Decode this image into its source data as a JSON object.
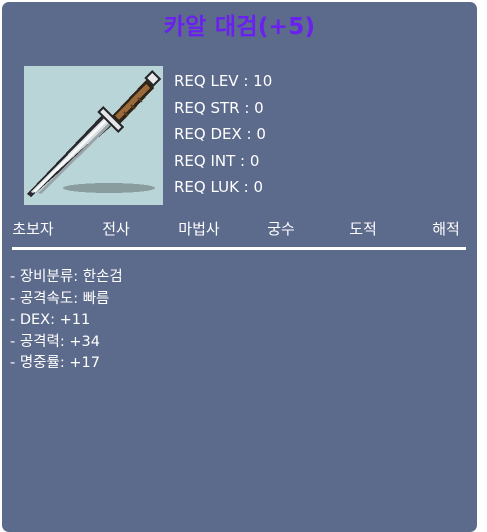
{
  "item": {
    "name": "카알 대검(+5)",
    "name_color": "#6a20f0",
    "icon": "sword-icon"
  },
  "requirements": [
    {
      "label": "REQ LEV : 10"
    },
    {
      "label": "REQ STR : 0"
    },
    {
      "label": "REQ DEX : 0"
    },
    {
      "label": "REQ INT : 0"
    },
    {
      "label": "REQ LUK : 0"
    }
  ],
  "jobs": [
    {
      "label": "초보자"
    },
    {
      "label": "전사"
    },
    {
      "label": "마법사"
    },
    {
      "label": "궁수"
    },
    {
      "label": "도적"
    },
    {
      "label": "해적"
    }
  ],
  "stats": [
    {
      "text": "- 장비분류: 한손검"
    },
    {
      "text": "- 공격속도: 빠름"
    },
    {
      "text": "- DEX: +11"
    },
    {
      "text": "- 공격력: +34"
    },
    {
      "text": "- 명중률: +17"
    }
  ],
  "colors": {
    "panel_bg": "#5c6a8c",
    "icon_bg": "#b9d5d7",
    "text": "#ffffff"
  }
}
